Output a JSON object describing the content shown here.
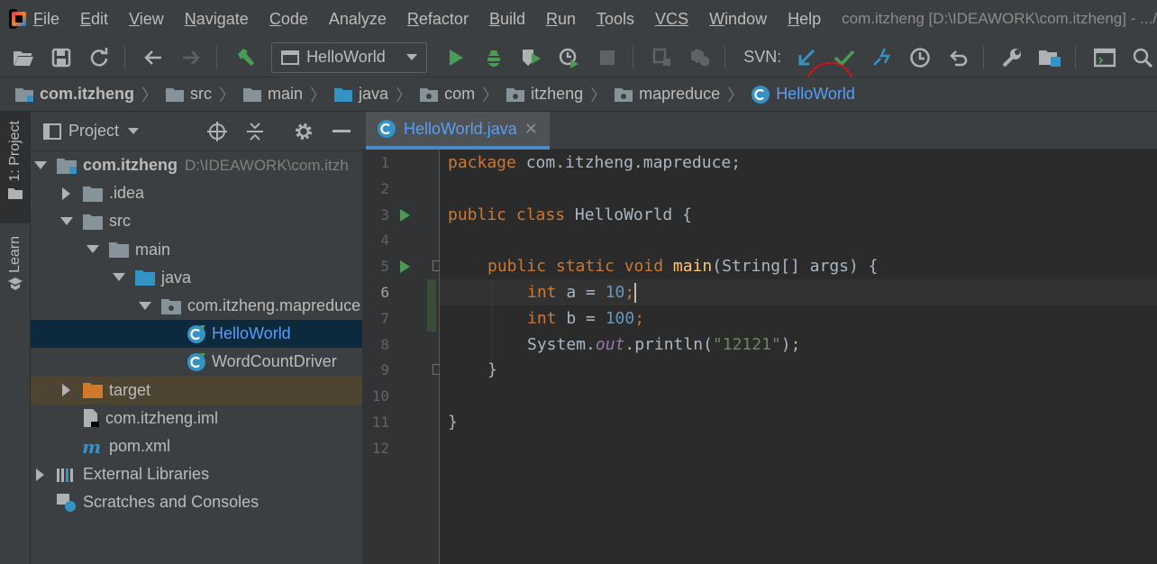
{
  "menu": {
    "items": [
      {
        "mnemonic": "F",
        "rest": "ile"
      },
      {
        "mnemonic": "E",
        "rest": "dit"
      },
      {
        "mnemonic": "V",
        "rest": "iew"
      },
      {
        "mnemonic": "N",
        "rest": "avigate"
      },
      {
        "mnemonic": "C",
        "rest": "ode"
      },
      {
        "mnemonic": "",
        "rest": "Analyze"
      },
      {
        "mnemonic": "R",
        "rest": "efactor"
      },
      {
        "mnemonic": "B",
        "rest": "uild"
      },
      {
        "mnemonic": "R",
        "rest": "un"
      },
      {
        "mnemonic": "T",
        "rest": "ools"
      },
      {
        "mnemonic": "",
        "rest": "VCS"
      },
      {
        "mnemonic": "W",
        "rest": "indow"
      },
      {
        "mnemonic": "H",
        "rest": "elp"
      }
    ],
    "window_title": "com.itzheng [D:\\IDEAWORK\\com.itzheng] - .../"
  },
  "toolbar": {
    "run_config": "HelloWorld",
    "svn_label": "SVN:",
    "colors": {
      "run": "#499c54",
      "svn_update": "#3592c4",
      "svn_commit": "#499c54",
      "highlight": "#d0121b"
    }
  },
  "breadcrumb": [
    {
      "label": "com.itzheng",
      "icon": "module-folder-icon"
    },
    {
      "label": "src",
      "icon": "folder-icon"
    },
    {
      "label": "main",
      "icon": "folder-icon"
    },
    {
      "label": "java",
      "icon": "source-folder-icon"
    },
    {
      "label": "com",
      "icon": "package-icon"
    },
    {
      "label": "itzheng",
      "icon": "package-icon"
    },
    {
      "label": "mapreduce",
      "icon": "package-icon"
    },
    {
      "label": "HelloWorld",
      "icon": "class-icon"
    }
  ],
  "tool_stripe": {
    "project_tab": "1: Project",
    "learn_tab": "Learn"
  },
  "project_panel": {
    "title": "Project",
    "tree": [
      {
        "label": "com.itzheng",
        "path": "D:\\IDEAWORK\\com.itzh",
        "depth": 0,
        "expanded": true,
        "icon": "module-folder-icon"
      },
      {
        "label": ".idea",
        "depth": 1,
        "expanded": false,
        "icon": "folder-icon"
      },
      {
        "label": "src",
        "depth": 1,
        "expanded": true,
        "icon": "folder-icon"
      },
      {
        "label": "main",
        "depth": 2,
        "expanded": true,
        "icon": "folder-icon"
      },
      {
        "label": "java",
        "depth": 3,
        "expanded": true,
        "icon": "source-folder-icon"
      },
      {
        "label": "com.itzheng.mapreduce",
        "depth": 4,
        "expanded": true,
        "icon": "package-icon"
      },
      {
        "label": "HelloWorld",
        "depth": 5,
        "icon": "class-icon",
        "selected": true
      },
      {
        "label": "WordCountDriver",
        "depth": 5,
        "icon": "class-icon"
      },
      {
        "label": "target",
        "depth": 1,
        "expanded": false,
        "icon": "excluded-folder-icon",
        "excluded": true
      },
      {
        "label": "com.itzheng.iml",
        "depth": 1,
        "icon": "iml-file-icon"
      },
      {
        "label": "pom.xml",
        "depth": 1,
        "icon": "maven-icon"
      },
      {
        "label": "External Libraries",
        "depth": 0,
        "expanded": false,
        "icon": "libraries-icon"
      },
      {
        "label": "Scratches and Consoles",
        "depth": 0,
        "icon": "scratches-icon"
      }
    ]
  },
  "editor": {
    "tab_label": "HelloWorld.java",
    "current_line": 6,
    "line_numbers": [
      "1",
      "2",
      "3",
      "4",
      "5",
      "6",
      "7",
      "8",
      "9",
      "10",
      "11",
      "12"
    ],
    "lines": {
      "l1": {
        "kw": "package",
        "rest": " com.itzheng.mapreduce;"
      },
      "l3": {
        "kw": "public class",
        "name": " HelloWorld ",
        "brace": "{"
      },
      "l5": {
        "kw": "public static void",
        "fn": "main",
        "params": "(String[] args) ",
        "brace": "{"
      },
      "l6": {
        "kw": "int",
        "var": " a = ",
        "num": "10",
        "end": ";"
      },
      "l7": {
        "kw": "int",
        "var": " b = ",
        "num": "100",
        "end": ";"
      },
      "l8": {
        "pre": "System.",
        "field": "out",
        "call": ".println(",
        "str": "\"12121\"",
        "end": ");"
      },
      "l9": {
        "brace": "}"
      },
      "l11": {
        "brace": "}"
      }
    }
  }
}
